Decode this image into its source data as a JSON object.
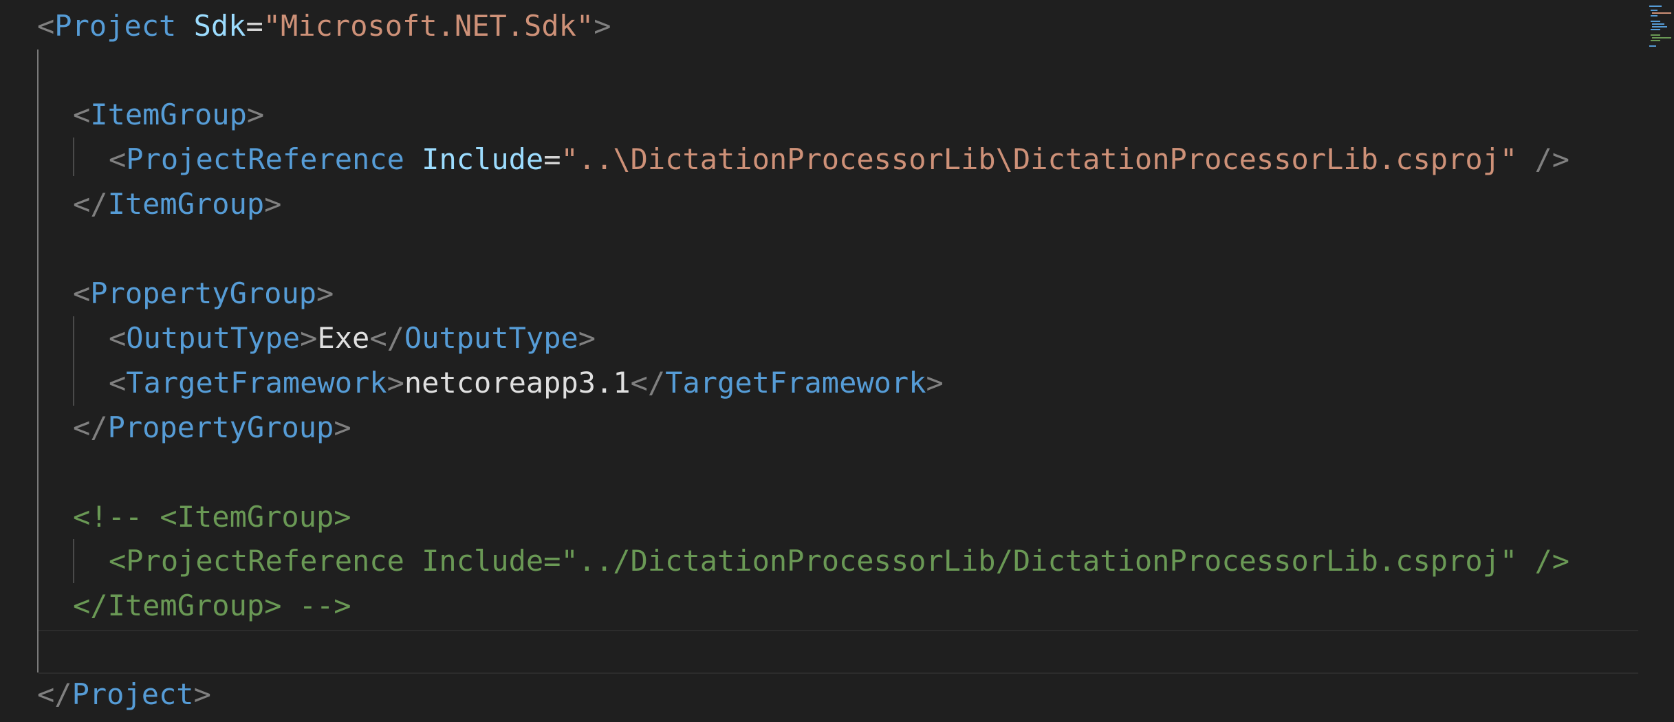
{
  "editor": {
    "lines": [
      {
        "segments": [
          {
            "t": "<",
            "c": "tag-bracket"
          },
          {
            "t": "Project",
            "c": "tag-name"
          },
          {
            "t": " ",
            "c": "attr-eq"
          },
          {
            "t": "Sdk",
            "c": "attr-name"
          },
          {
            "t": "=",
            "c": "attr-eq"
          },
          {
            "t": "\"Microsoft.NET.Sdk\"",
            "c": "attr-val"
          },
          {
            "t": ">",
            "c": "tag-bracket"
          }
        ]
      },
      {
        "segments": []
      },
      {
        "segments": [
          {
            "t": "<",
            "c": "tag-bracket"
          },
          {
            "t": "ItemGroup",
            "c": "tag-name"
          },
          {
            "t": ">",
            "c": "tag-bracket"
          }
        ]
      },
      {
        "segments": [
          {
            "t": "<",
            "c": "tag-bracket"
          },
          {
            "t": "ProjectReference",
            "c": "tag-name"
          },
          {
            "t": " ",
            "c": "attr-eq"
          },
          {
            "t": "Include",
            "c": "attr-name"
          },
          {
            "t": "=",
            "c": "attr-eq"
          },
          {
            "t": "\"..\\DictationProcessorLib\\DictationProcessorLib.csproj\"",
            "c": "attr-val"
          },
          {
            "t": " />",
            "c": "tag-bracket"
          }
        ]
      },
      {
        "segments": [
          {
            "t": "</",
            "c": "tag-bracket"
          },
          {
            "t": "ItemGroup",
            "c": "tag-name"
          },
          {
            "t": ">",
            "c": "tag-bracket"
          }
        ]
      },
      {
        "segments": []
      },
      {
        "segments": [
          {
            "t": "<",
            "c": "tag-bracket"
          },
          {
            "t": "PropertyGroup",
            "c": "tag-name"
          },
          {
            "t": ">",
            "c": "tag-bracket"
          }
        ]
      },
      {
        "segments": [
          {
            "t": "<",
            "c": "tag-bracket"
          },
          {
            "t": "OutputType",
            "c": "tag-name"
          },
          {
            "t": ">",
            "c": "tag-bracket"
          },
          {
            "t": "Exe",
            "c": "text"
          },
          {
            "t": "</",
            "c": "tag-bracket"
          },
          {
            "t": "OutputType",
            "c": "tag-name"
          },
          {
            "t": ">",
            "c": "tag-bracket"
          }
        ]
      },
      {
        "segments": [
          {
            "t": "<",
            "c": "tag-bracket"
          },
          {
            "t": "TargetFramework",
            "c": "tag-name"
          },
          {
            "t": ">",
            "c": "tag-bracket"
          },
          {
            "t": "netcoreapp3.1",
            "c": "text"
          },
          {
            "t": "</",
            "c": "tag-bracket"
          },
          {
            "t": "TargetFramework",
            "c": "tag-name"
          },
          {
            "t": ">",
            "c": "tag-bracket"
          }
        ]
      },
      {
        "segments": [
          {
            "t": "</",
            "c": "tag-bracket"
          },
          {
            "t": "PropertyGroup",
            "c": "tag-name"
          },
          {
            "t": ">",
            "c": "tag-bracket"
          }
        ]
      },
      {
        "segments": []
      },
      {
        "segments": [
          {
            "t": "<!-- <ItemGroup>",
            "c": "comment"
          }
        ]
      },
      {
        "segments": [
          {
            "t": "<ProjectReference Include=\"../DictationProcessorLib/DictationProcessorLib.csproj\" />",
            "c": "comment"
          }
        ]
      },
      {
        "segments": [
          {
            "t": "</ItemGroup> -->",
            "c": "comment"
          }
        ]
      },
      {
        "segments": []
      },
      {
        "segments": [
          {
            "t": "</",
            "c": "tag-bracket"
          },
          {
            "t": "Project",
            "c": "tag-name"
          },
          {
            "t": ">",
            "c": "tag-bracket"
          }
        ]
      }
    ],
    "colors": {
      "background": "#1f1f1f",
      "tag_bracket": "#808080",
      "tag_name": "#569cd6",
      "attr_name": "#9cdcfe",
      "attr_value": "#ce9178",
      "comment": "#6a9955",
      "text": "#e0e0e0"
    }
  }
}
